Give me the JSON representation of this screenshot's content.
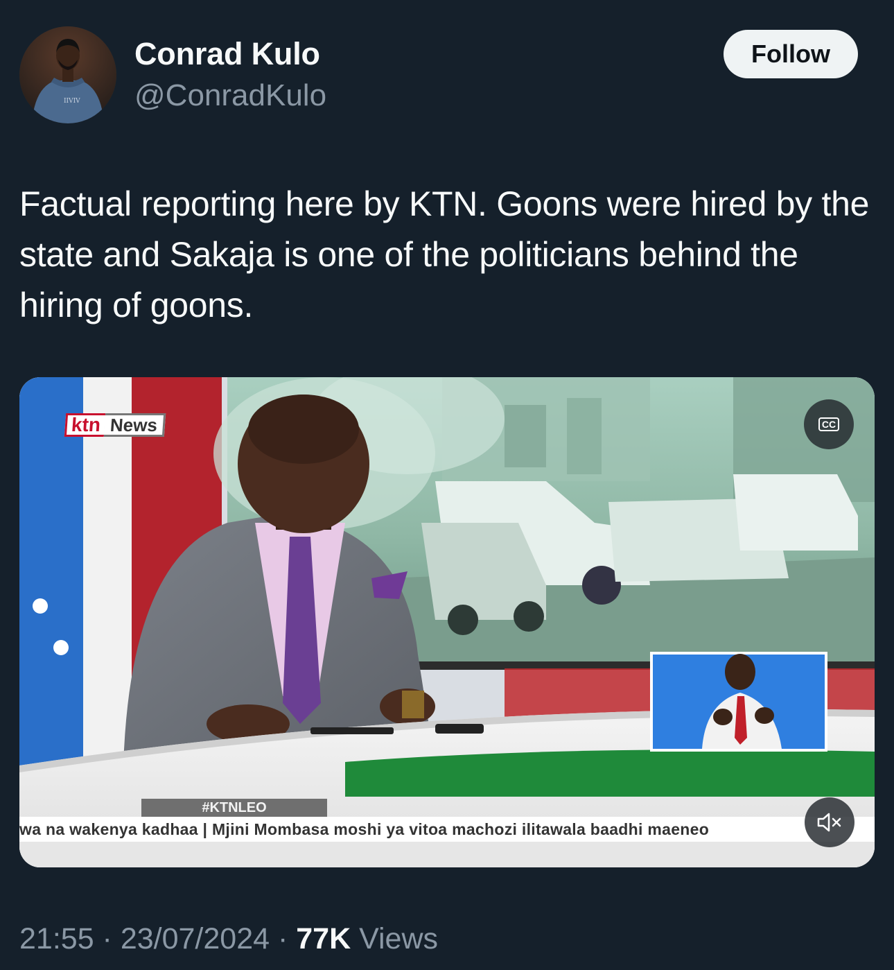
{
  "author": {
    "display_name": "Conrad Kulo",
    "handle": "@ConradKulo",
    "avatar_shirt_text": "IIVIV"
  },
  "follow_button": {
    "label": "Follow"
  },
  "tweet": {
    "text": "Factual reporting here by KTN. Goons were hired by the state and Sakaja is one of the politicians behind the hiring of goons."
  },
  "media": {
    "logo_brand": "ktn",
    "logo_sub": "News",
    "hashtag": "#KTNLEO",
    "ticker": "wa na wakenya kadhaa  |  Mjini Mombasa moshi ya vitoa machozi ilitawala baadhi maeneo",
    "cc_label": "CC",
    "cc_icon": "closed-captions-icon",
    "mute_icon": "volume-muted-icon"
  },
  "footer": {
    "time": "21:55",
    "sep1": " · ",
    "date": "23/07/2024",
    "sep2": " · ",
    "views_count": "77K",
    "views_label": " Views"
  },
  "colors": {
    "background": "#15202b",
    "primary_text": "#f7f9f9",
    "secondary_text": "#8b98a5",
    "follow_bg": "#eff3f4",
    "ktn_red": "#c8102e"
  }
}
